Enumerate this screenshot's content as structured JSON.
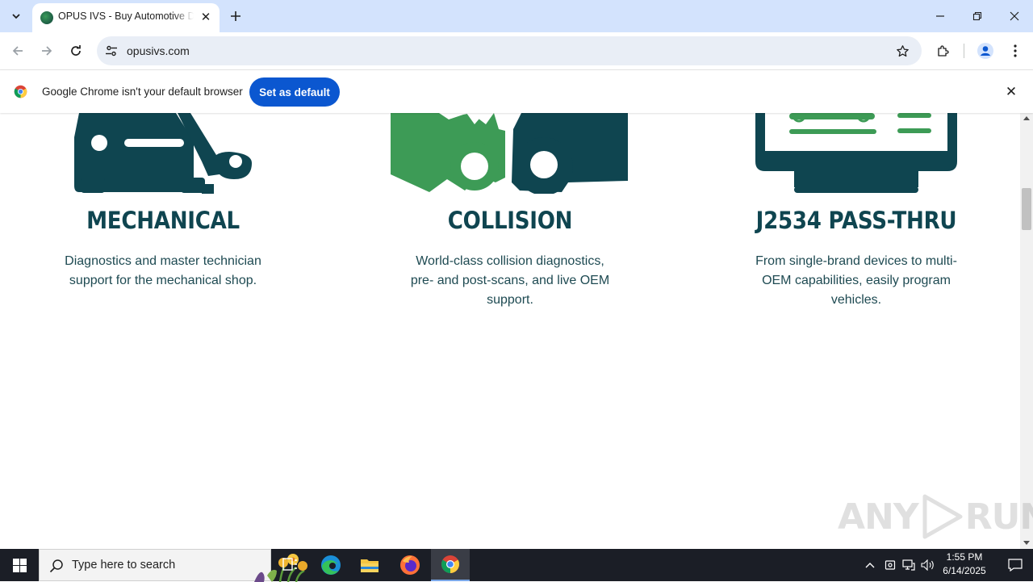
{
  "browser": {
    "tab": {
      "title": "OPUS IVS - Buy Automotive Diagnostic Tools",
      "favicon": "opus-ivs-favicon"
    },
    "toolbar": {
      "url": "opusivs.com"
    },
    "infobar": {
      "message": "Google Chrome isn't your default browser",
      "button_label": "Set as default"
    }
  },
  "page": {
    "cards": [
      {
        "title": "MECHANICAL",
        "description": "Diagnostics and master technician support for the mechanical shop.",
        "icon": "car-wrench-icon"
      },
      {
        "title": "COLLISION",
        "description": "World-class collision diagnostics, pre- and post-scans, and live OEM support.",
        "icon": "car-collision-icon"
      },
      {
        "title": "J2534 PASS-THRU",
        "description": "From single-brand devices to multi-OEM capabilities, easily program vehicles.",
        "icon": "monitor-icon"
      }
    ],
    "colors": {
      "dark_teal": "#0f4550",
      "green": "#3d9b56",
      "text": "#1e4a52"
    }
  },
  "watermark": {
    "text_left": "ANY",
    "text_right": "RUN"
  },
  "taskbar": {
    "search_placeholder": "Type here to search",
    "apps": [
      "task-view-icon",
      "edge-icon",
      "file-explorer-icon",
      "firefox-icon",
      "chrome-icon"
    ],
    "clock": {
      "time": "1:55 PM",
      "date": "6/14/2025"
    }
  }
}
